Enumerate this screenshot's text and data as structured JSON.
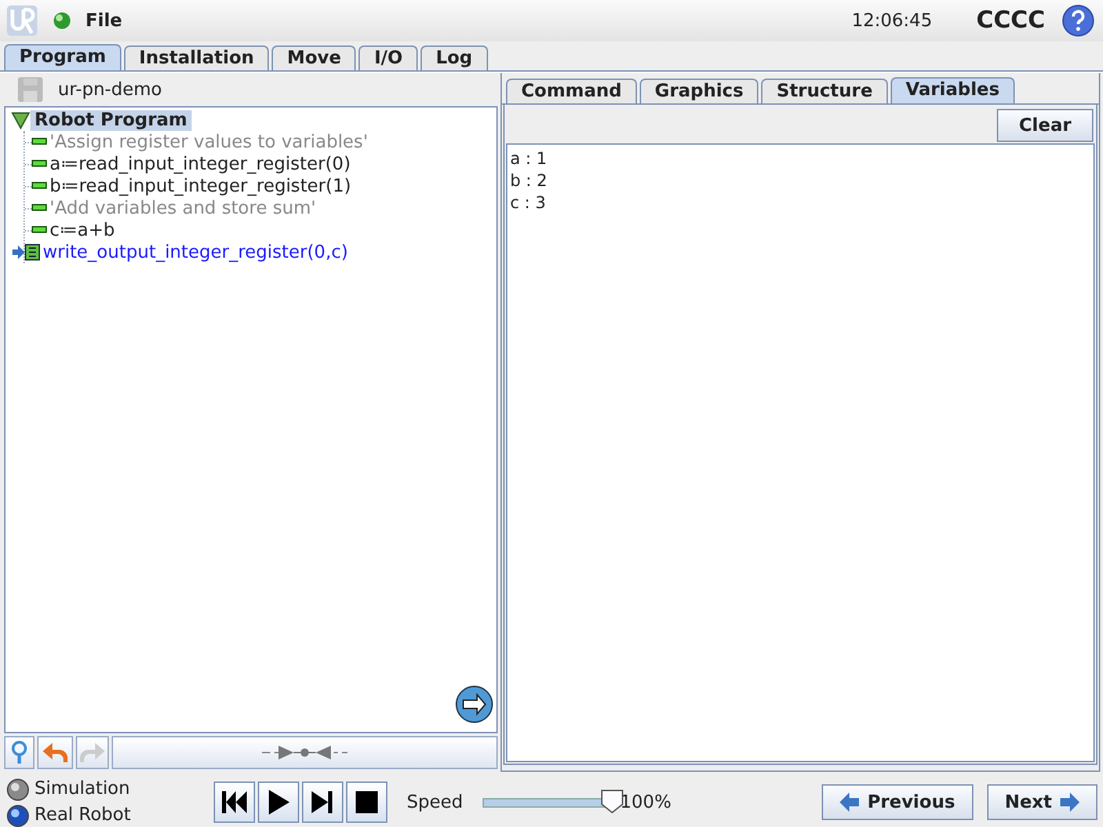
{
  "top_bar": {
    "menu": "File",
    "time": "12:06:45",
    "robot_name": "CCCC"
  },
  "main_tabs": [
    {
      "label": "Program",
      "selected": true
    },
    {
      "label": "Installation",
      "selected": false
    },
    {
      "label": "Move",
      "selected": false
    },
    {
      "label": "I/O",
      "selected": false
    },
    {
      "label": "Log",
      "selected": false
    }
  ],
  "program_name": "ur-pn-demo",
  "program_tree": {
    "label": "Robot Program",
    "expanded": true,
    "selected": true,
    "children": [
      {
        "kind": "comment",
        "label": "'Assign register values to variables'"
      },
      {
        "kind": "statement",
        "label": "a≔read_input_integer_register(0)"
      },
      {
        "kind": "statement",
        "label": "b≔read_input_integer_register(1)"
      },
      {
        "kind": "comment",
        "label": "'Add variables and store sum'"
      },
      {
        "kind": "statement",
        "label": "c≔a+b"
      },
      {
        "kind": "current",
        "label": "write_output_integer_register(0,c)"
      }
    ]
  },
  "side_tabs": [
    {
      "label": "Command",
      "selected": false
    },
    {
      "label": "Graphics",
      "selected": false
    },
    {
      "label": "Structure",
      "selected": false
    },
    {
      "label": "Variables",
      "selected": true
    }
  ],
  "clear_button": "Clear",
  "variables": [
    "a : 1",
    "b : 2",
    "c : 3"
  ],
  "modes": [
    {
      "label": "Simulation",
      "selected": false
    },
    {
      "label": "Real Robot",
      "selected": true
    }
  ],
  "speed": {
    "label": "Speed",
    "level": 1.0,
    "reading": "100%"
  },
  "nav_buttons": {
    "previous": "Previous",
    "next": "Next"
  }
}
